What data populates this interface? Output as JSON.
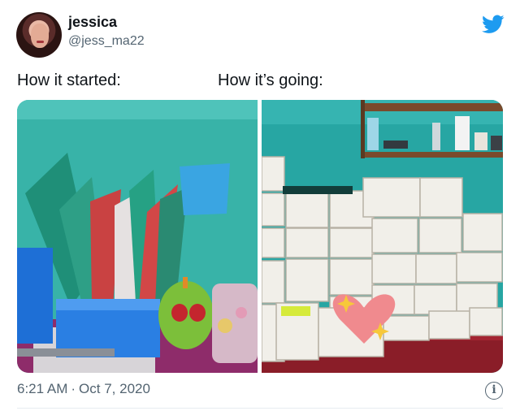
{
  "user": {
    "name": "jessica",
    "handle": "@jess_ma22"
  },
  "captions": {
    "left": "How it started:",
    "right": "How it’s going:"
  },
  "meta": {
    "time": "6:21 AM",
    "separator": "·",
    "date": "Oct 7, 2020"
  },
  "icons": {
    "brand": "twitter-bird-icon",
    "info": "info-icon"
  },
  "colors": {
    "brand_blue": "#1d9bf0",
    "text_primary": "#0f1419",
    "text_secondary": "#536471"
  }
}
